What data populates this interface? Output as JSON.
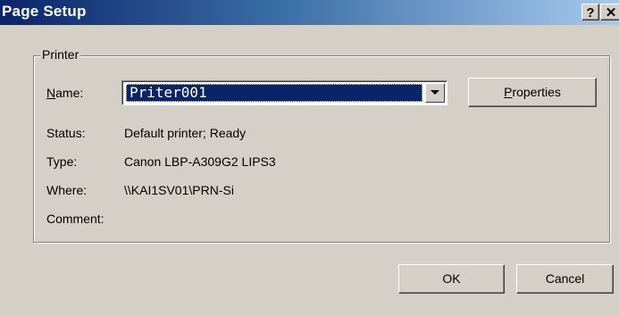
{
  "window": {
    "title": "Page Setup",
    "help_glyph": "?",
    "close_glyph": "✕"
  },
  "printer_group": {
    "label": "Printer",
    "name_label_mnemonic": "N",
    "name_label_rest": "ame:",
    "selected_printer": "Priter001",
    "properties_mnemonic": "P",
    "properties_rest": "roperties",
    "status_label": "Status:",
    "status_value": "Default printer; Ready",
    "type_label": "Type:",
    "type_value": "Canon LBP-A309G2 LIPS3",
    "where_label": "Where:",
    "where_value": "\\\\KAI1SV01\\PRN-Si",
    "comment_label": "Comment:",
    "comment_value": ""
  },
  "buttons": {
    "ok": "OK",
    "cancel": "Cancel"
  },
  "colors": {
    "dialog_face": "#d4d0c8",
    "title_active": "#0a246a",
    "selection": "#0a246a"
  }
}
